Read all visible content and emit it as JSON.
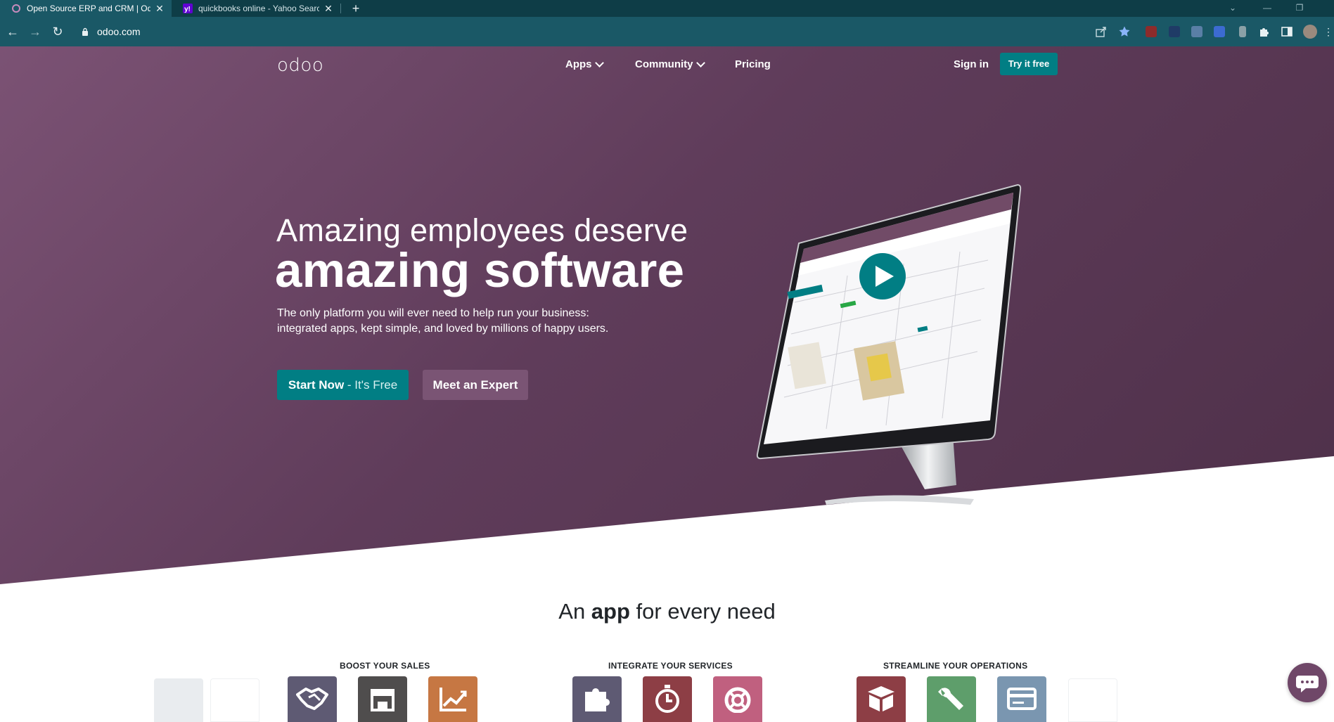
{
  "browser": {
    "tabs": [
      {
        "title": "Open Source ERP and CRM | Odoo",
        "active": true,
        "favicon": "odoo-circle-icon"
      },
      {
        "title": "quickbooks online - Yahoo Search",
        "active": false,
        "favicon": "yahoo-icon"
      }
    ],
    "url": "odoo.com",
    "colors": {
      "frame": "#0e3d47",
      "toolbar": "#1a5866"
    }
  },
  "nav": {
    "logo": "odoo",
    "links": [
      "Apps",
      "Community",
      "Pricing"
    ],
    "sign_in": "Sign in",
    "try_free": "Try it free"
  },
  "hero": {
    "line1": "Amazing employees deserve",
    "line2": "amazing software",
    "subtitle_1": "The only platform you will ever need to help run your business:",
    "subtitle_2": "integrated apps, kept simple, and loved by millions of happy users.",
    "cta_primary_main": "Start Now",
    "cta_primary_suffix": " - It's Free",
    "cta_secondary": "Meet an Expert",
    "colors": {
      "hero_bg": "#6b4664",
      "primary": "#017e84",
      "secondary": "#7a5474"
    }
  },
  "apps_section": {
    "title_pre": "An ",
    "title_bold": "app",
    "title_post": " for every need",
    "categories": [
      "BOOST YOUR SALES",
      "INTEGRATE YOUR SERVICES",
      "STREAMLINE YOUR OPERATIONS"
    ],
    "apps": [
      {
        "icon": "handshake-icon",
        "color": "#5e5a73"
      },
      {
        "icon": "store-icon",
        "color": "#4f4d4d"
      },
      {
        "icon": "chart-up-icon",
        "color": "#c67743"
      },
      {
        "icon": "puzzle-icon",
        "color": "#5e5a73"
      },
      {
        "icon": "stopwatch-icon",
        "color": "#8d3e45"
      },
      {
        "icon": "lifebuoy-icon",
        "color": "#c0607f"
      },
      {
        "icon": "box-icon",
        "color": "#8d3e45"
      },
      {
        "icon": "wrench-icon",
        "color": "#5e9e6b"
      },
      {
        "icon": "card-icon",
        "color": "#7a96b0"
      }
    ]
  }
}
